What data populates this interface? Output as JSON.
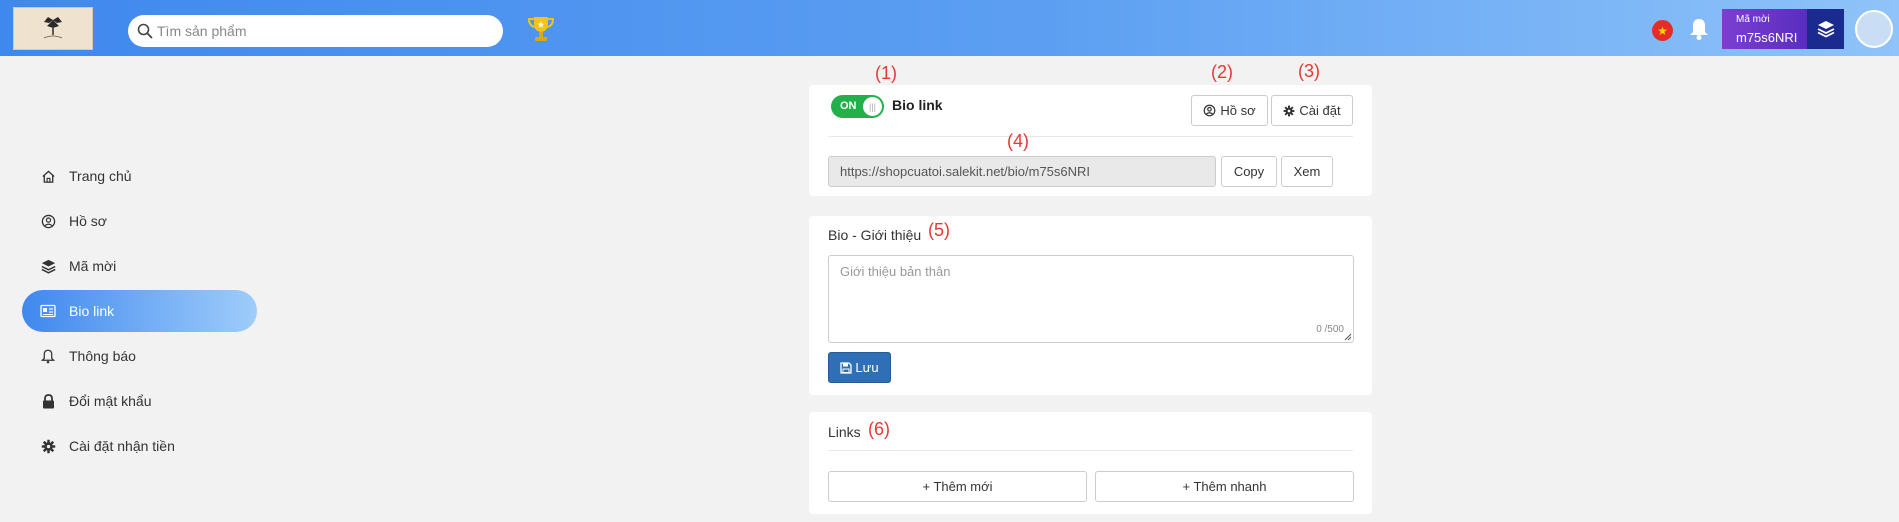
{
  "header": {
    "search_placeholder": "Tìm sản phẩm",
    "referral_label": "Mã mời",
    "referral_code": "m75s6NRI"
  },
  "sidebar": {
    "items": [
      {
        "label": "Trang chủ",
        "icon": "home-icon"
      },
      {
        "label": "Hồ sơ",
        "icon": "user-circle-icon"
      },
      {
        "label": "Mã mời",
        "icon": "layers-icon"
      },
      {
        "label": "Bio link",
        "icon": "id-card-icon",
        "active": true
      },
      {
        "label": "Thông báo",
        "icon": "bell-icon"
      },
      {
        "label": "Đổi mật khẩu",
        "icon": "lock-icon"
      },
      {
        "label": "Cài đặt nhận tiền",
        "icon": "gear-icon"
      }
    ]
  },
  "bio_card": {
    "toggle_label": "ON",
    "title": "Bio link",
    "profile_button": "Hồ sơ",
    "settings_button": "Cài đặt",
    "url": "https://shopcuatoi.salekit.net/bio/m75s6NRI",
    "copy_button": "Copy",
    "view_button": "Xem"
  },
  "intro_card": {
    "title": "Bio - Giới thiệu",
    "placeholder": "Giới thiệu bản thân",
    "counter": "0 /500",
    "save_button": "Lưu"
  },
  "links_card": {
    "title": "Links",
    "add_new_button": "+ Thêm mới",
    "quick_add_button": "+ Thêm nhanh"
  },
  "annotations": [
    "(1)",
    "(2)",
    "(3)",
    "(4)",
    "(5)",
    "(6)"
  ],
  "colors": {
    "header_start": "#3f88ee",
    "header_end": "#8fc3f9",
    "toggle_on": "#22b04b",
    "save_button": "#2f6fb5",
    "referral_bg": "#7b3fd1",
    "layers_bg": "#1b2a8f",
    "annotation": "#e53935"
  }
}
